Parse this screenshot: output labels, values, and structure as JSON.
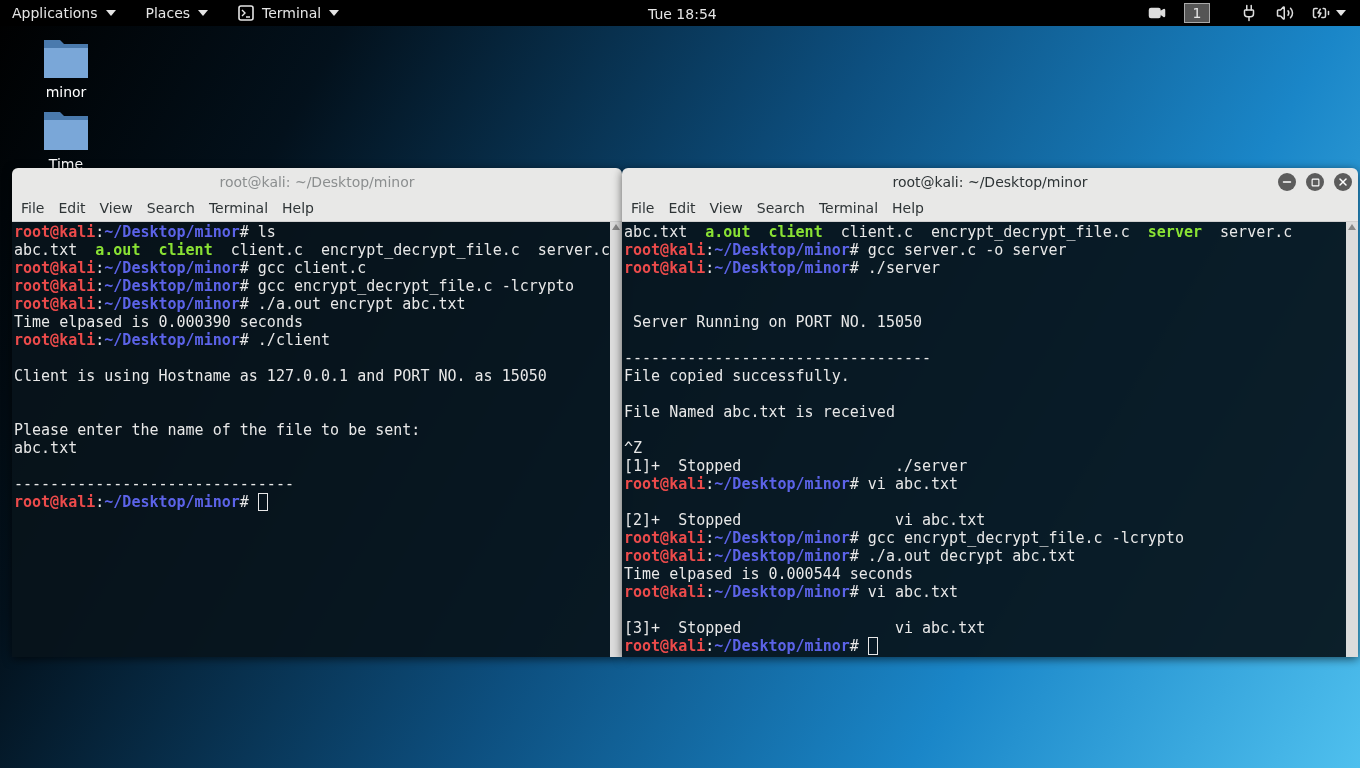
{
  "top_bar": {
    "menus": [
      {
        "label": "Applications",
        "kind": "menu"
      },
      {
        "label": "Places",
        "kind": "menu"
      },
      {
        "label": "Terminal",
        "kind": "app"
      }
    ],
    "clock": "Tue 18:54",
    "workspace": "1"
  },
  "desktop_icons": [
    {
      "label": "minor"
    },
    {
      "label": "Time"
    }
  ],
  "windows": [
    {
      "title": "root@kali: ~/Desktop/minor",
      "active": false,
      "menu": [
        "File",
        "Edit",
        "View",
        "Search",
        "Terminal",
        "Help"
      ],
      "lines": [
        {
          "kind": "prompt",
          "user": "root@kali",
          "colon": ":",
          "path": "~/Desktop/minor",
          "mark": "#",
          "command": " ls",
          "cursor": false
        },
        {
          "kind": "ls",
          "files": [
            {
              "name": "abc.txt",
              "executable": false
            },
            {
              "name": "a.out",
              "executable": true
            },
            {
              "name": "client",
              "executable": true
            },
            {
              "name": "client.c",
              "executable": false
            },
            {
              "name": "encrypt_decrypt_file.c",
              "executable": false
            },
            {
              "name": "server.c",
              "executable": false
            }
          ]
        },
        {
          "kind": "prompt",
          "user": "root@kali",
          "colon": ":",
          "path": "~/Desktop/minor",
          "mark": "#",
          "command": " gcc client.c",
          "cursor": false
        },
        {
          "kind": "prompt",
          "user": "root@kali",
          "colon": ":",
          "path": "~/Desktop/minor",
          "mark": "#",
          "command": " gcc encrypt_decrypt_file.c -lcrypto",
          "cursor": false
        },
        {
          "kind": "prompt",
          "user": "root@kali",
          "colon": ":",
          "path": "~/Desktop/minor",
          "mark": "#",
          "command": " ./a.out encrypt abc.txt",
          "cursor": false
        },
        {
          "kind": "text",
          "text": "Time elpased is 0.000390 seconds"
        },
        {
          "kind": "prompt",
          "user": "root@kali",
          "colon": ":",
          "path": "~/Desktop/minor",
          "mark": "#",
          "command": " ./client",
          "cursor": false
        },
        {
          "kind": "blank"
        },
        {
          "kind": "text",
          "text": "Client is using Hostname as 127.0.0.1 and PORT NO. as 15050"
        },
        {
          "kind": "blank"
        },
        {
          "kind": "blank"
        },
        {
          "kind": "text",
          "text": "Please enter the name of the file to be sent:"
        },
        {
          "kind": "text",
          "text": "abc.txt"
        },
        {
          "kind": "blank"
        },
        {
          "kind": "text",
          "text": "-------------------------------"
        },
        {
          "kind": "prompt",
          "user": "root@kali",
          "colon": ":",
          "path": "~/Desktop/minor",
          "mark": "#",
          "cursor": true
        }
      ]
    },
    {
      "title": "root@kali: ~/Desktop/minor",
      "active": true,
      "menu": [
        "File",
        "Edit",
        "View",
        "Search",
        "Terminal",
        "Help"
      ],
      "lines": [
        {
          "kind": "ls",
          "files": [
            {
              "name": "abc.txt",
              "executable": false
            },
            {
              "name": "a.out",
              "executable": true
            },
            {
              "name": "client",
              "executable": true
            },
            {
              "name": "client.c",
              "executable": false
            },
            {
              "name": "encrypt_decrypt_file.c",
              "executable": false
            },
            {
              "name": "server",
              "executable": true
            },
            {
              "name": "server.c",
              "executable": false
            }
          ]
        },
        {
          "kind": "prompt",
          "user": "root@kali",
          "colon": ":",
          "path": "~/Desktop/minor",
          "mark": "#",
          "command": " gcc server.c -o server",
          "cursor": false
        },
        {
          "kind": "prompt",
          "user": "root@kali",
          "colon": ":",
          "path": "~/Desktop/minor",
          "mark": "#",
          "command": " ./server",
          "cursor": false
        },
        {
          "kind": "blank"
        },
        {
          "kind": "blank"
        },
        {
          "kind": "text",
          "text": " Server Running on PORT NO. 15050"
        },
        {
          "kind": "blank"
        },
        {
          "kind": "text",
          "text": "----------------------------------"
        },
        {
          "kind": "text",
          "text": "File copied successfully."
        },
        {
          "kind": "blank"
        },
        {
          "kind": "text",
          "text": "File Named abc.txt is received"
        },
        {
          "kind": "blank"
        },
        {
          "kind": "text",
          "text": "^Z"
        },
        {
          "kind": "text",
          "text": "[1]+  Stopped                 ./server"
        },
        {
          "kind": "prompt",
          "user": "root@kali",
          "colon": ":",
          "path": "~/Desktop/minor",
          "mark": "#",
          "command": " vi abc.txt",
          "cursor": false
        },
        {
          "kind": "blank"
        },
        {
          "kind": "text",
          "text": "[2]+  Stopped                 vi abc.txt"
        },
        {
          "kind": "prompt",
          "user": "root@kali",
          "colon": ":",
          "path": "~/Desktop/minor",
          "mark": "#",
          "command": " gcc encrypt_decrypt_file.c -lcrypto",
          "cursor": false
        },
        {
          "kind": "prompt",
          "user": "root@kali",
          "colon": ":",
          "path": "~/Desktop/minor",
          "mark": "#",
          "command": " ./a.out decrypt abc.txt",
          "cursor": false
        },
        {
          "kind": "text",
          "text": "Time elpased is 0.000544 seconds"
        },
        {
          "kind": "prompt",
          "user": "root@kali",
          "colon": ":",
          "path": "~/Desktop/minor",
          "mark": "#",
          "command": " vi abc.txt",
          "cursor": false
        },
        {
          "kind": "blank"
        },
        {
          "kind": "text",
          "text": "[3]+  Stopped                 vi abc.txt"
        },
        {
          "kind": "prompt",
          "user": "root@kali",
          "colon": ":",
          "path": "~/Desktop/minor",
          "mark": "#",
          "cursor": true
        }
      ]
    }
  ]
}
